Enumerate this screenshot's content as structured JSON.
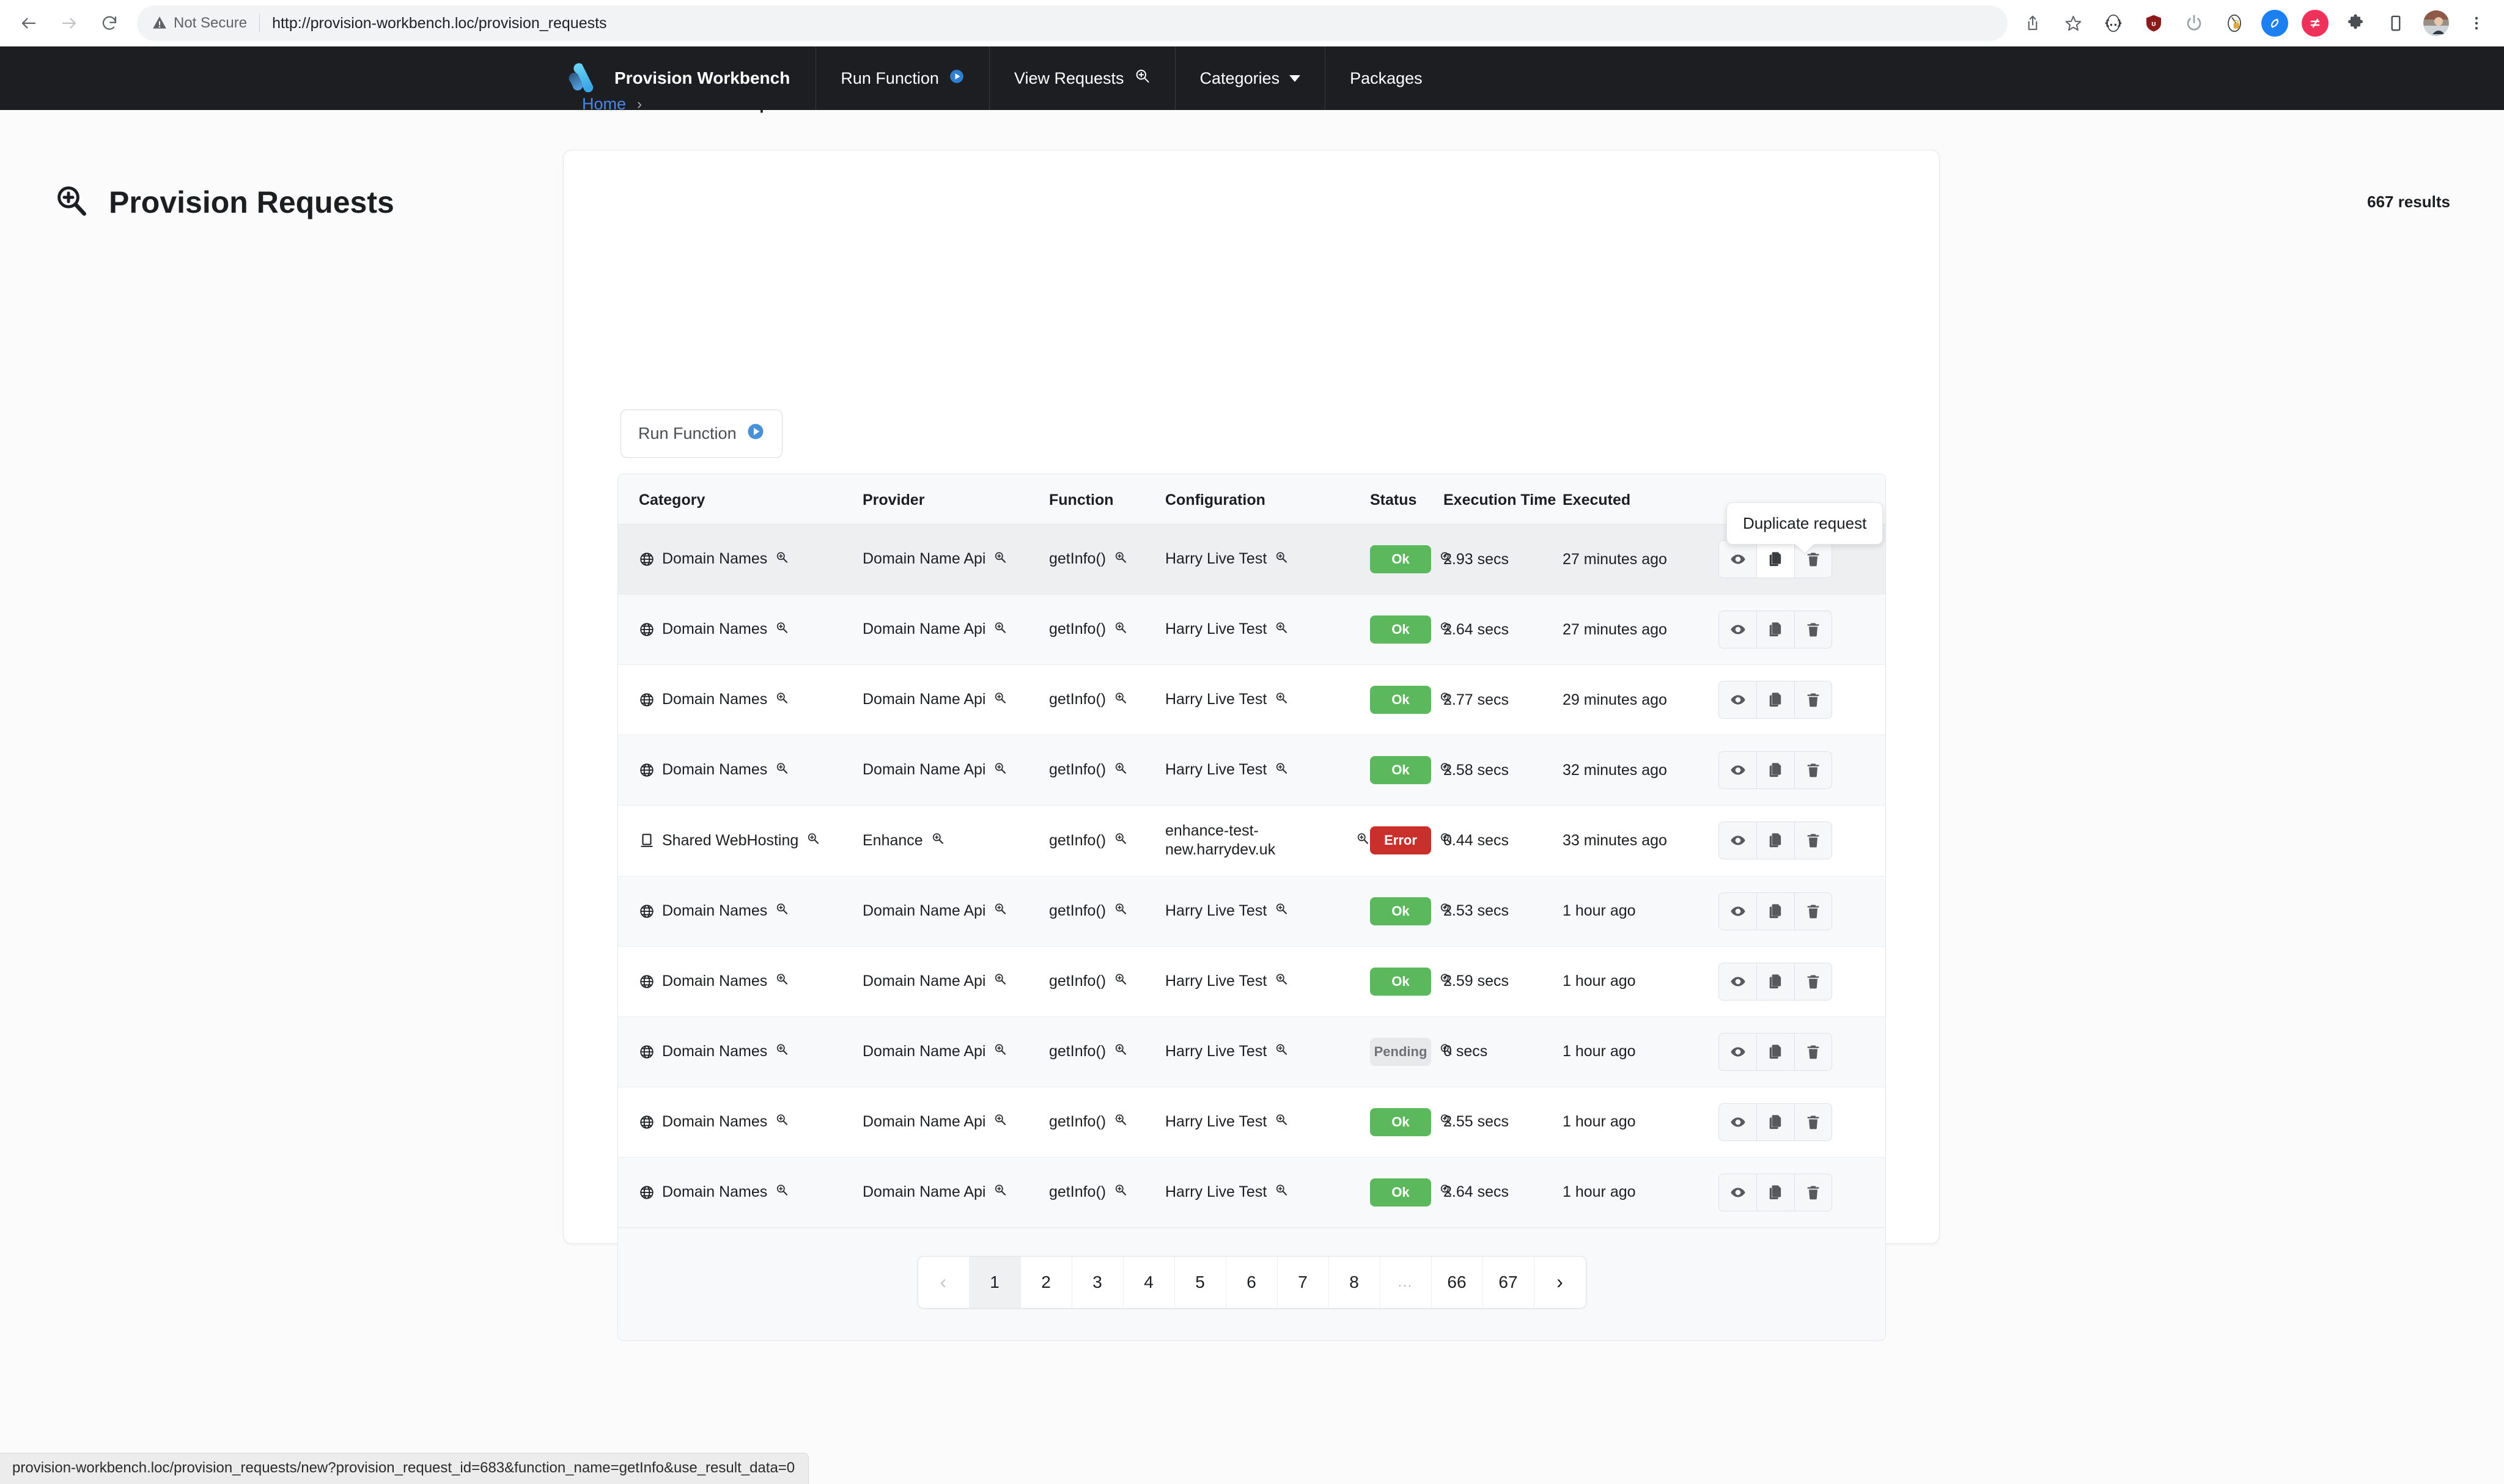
{
  "browser": {
    "security_label": "Not Secure",
    "url": "http://provision-workbench.loc/provision_requests",
    "nav": {
      "back": "back-arrow",
      "forward": "forward-arrow",
      "reload": "reload-icon"
    },
    "actions": [
      "share-icon",
      "bookmark-star-icon",
      "devtools-icon",
      "ublock-icon",
      "power-icon",
      "keychain-icon",
      "shazam-icon",
      "clipboard-icon",
      "extensions-puzzle-icon",
      "mobile-icon",
      "avatar",
      "kebab-menu-icon"
    ]
  },
  "site_nav": {
    "brand": "Provision Workbench",
    "items": [
      {
        "label": "Run Function",
        "icon": "play-circle-icon"
      },
      {
        "label": "View Requests",
        "icon": "search-plus-icon"
      },
      {
        "label": "Categories",
        "icon": "caret-down-icon"
      },
      {
        "label": "Packages",
        "icon": ""
      }
    ]
  },
  "breadcrumb": {
    "home": "Home",
    "separator": "›",
    "current": "Provision Requests"
  },
  "header": {
    "title": "Provision Requests",
    "icon": "search-plus-icon",
    "results": "667 results"
  },
  "toolbar": {
    "run_function_label": "Run Function",
    "run_function_icon": "play-circle-icon"
  },
  "tooltip": {
    "text": "Duplicate request"
  },
  "table": {
    "columns": [
      "Category",
      "Provider",
      "Function",
      "Configuration",
      "Status",
      "Execution Time",
      "Executed"
    ],
    "row_actions": [
      {
        "name": "view-request-button",
        "icon": "eye-icon"
      },
      {
        "name": "duplicate-request-button",
        "icon": "copy-icon"
      },
      {
        "name": "delete-request-button",
        "icon": "trash-icon"
      }
    ],
    "rows": [
      {
        "category": "Domain Names",
        "category_icon": "globe-icon",
        "provider": "Domain Name Api",
        "function": "getInfo()",
        "configuration": "Harry Live Test",
        "status": "Ok",
        "status_type": "ok",
        "execution_time": "2.93 secs",
        "executed": "27 minutes ago",
        "hover": true,
        "active_action": 1
      },
      {
        "category": "Domain Names",
        "category_icon": "globe-icon",
        "provider": "Domain Name Api",
        "function": "getInfo()",
        "configuration": "Harry Live Test",
        "status": "Ok",
        "status_type": "ok",
        "execution_time": "2.64 secs",
        "executed": "27 minutes ago",
        "hover": false,
        "active_action": -1
      },
      {
        "category": "Domain Names",
        "category_icon": "globe-icon",
        "provider": "Domain Name Api",
        "function": "getInfo()",
        "configuration": "Harry Live Test",
        "status": "Ok",
        "status_type": "ok",
        "execution_time": "2.77 secs",
        "executed": "29 minutes ago",
        "hover": false,
        "active_action": -1
      },
      {
        "category": "Domain Names",
        "category_icon": "globe-icon",
        "provider": "Domain Name Api",
        "function": "getInfo()",
        "configuration": "Harry Live Test",
        "status": "Ok",
        "status_type": "ok",
        "execution_time": "2.58 secs",
        "executed": "32 minutes ago",
        "hover": false,
        "active_action": -1
      },
      {
        "category": "Shared WebHosting",
        "category_icon": "monitor-icon",
        "provider": "Enhance",
        "function": "getInfo()",
        "configuration": "enhance-test-new.harrydev.uk",
        "status": "Error",
        "status_type": "error",
        "execution_time": "0.44 secs",
        "executed": "33 minutes ago",
        "hover": false,
        "active_action": -1
      },
      {
        "category": "Domain Names",
        "category_icon": "globe-icon",
        "provider": "Domain Name Api",
        "function": "getInfo()",
        "configuration": "Harry Live Test",
        "status": "Ok",
        "status_type": "ok",
        "execution_time": "2.53 secs",
        "executed": "1 hour ago",
        "hover": false,
        "active_action": -1
      },
      {
        "category": "Domain Names",
        "category_icon": "globe-icon",
        "provider": "Domain Name Api",
        "function": "getInfo()",
        "configuration": "Harry Live Test",
        "status": "Ok",
        "status_type": "ok",
        "execution_time": "2.59 secs",
        "executed": "1 hour ago",
        "hover": false,
        "active_action": -1
      },
      {
        "category": "Domain Names",
        "category_icon": "globe-icon",
        "provider": "Domain Name Api",
        "function": "getInfo()",
        "configuration": "Harry Live Test",
        "status": "Pending",
        "status_type": "pending",
        "execution_time": "0 secs",
        "executed": "1 hour ago",
        "hover": false,
        "active_action": -1
      },
      {
        "category": "Domain Names",
        "category_icon": "globe-icon",
        "provider": "Domain Name Api",
        "function": "getInfo()",
        "configuration": "Harry Live Test",
        "status": "Ok",
        "status_type": "ok",
        "execution_time": "2.55 secs",
        "executed": "1 hour ago",
        "hover": false,
        "active_action": -1
      },
      {
        "category": "Domain Names",
        "category_icon": "globe-icon",
        "provider": "Domain Name Api",
        "function": "getInfo()",
        "configuration": "Harry Live Test",
        "status": "Ok",
        "status_type": "ok",
        "execution_time": "2.64 secs",
        "executed": "1 hour ago",
        "hover": false,
        "active_action": -1
      }
    ]
  },
  "pagination": {
    "prev": "‹",
    "next": "›",
    "pages": [
      "1",
      "2",
      "3",
      "4",
      "5",
      "6",
      "7",
      "8",
      "...",
      "66",
      "67"
    ],
    "active": "1"
  },
  "status_bar": {
    "url": "provision-workbench.loc/provision_requests/new?provision_request_id=683&function_name=getInfo&use_result_data=0"
  },
  "colors": {
    "nav_bg": "#1c1e21",
    "accent_blue": "#4a86e8",
    "status_ok": "#5cb85c",
    "status_error": "#c9302c",
    "status_pending": "#e8e9eb"
  }
}
